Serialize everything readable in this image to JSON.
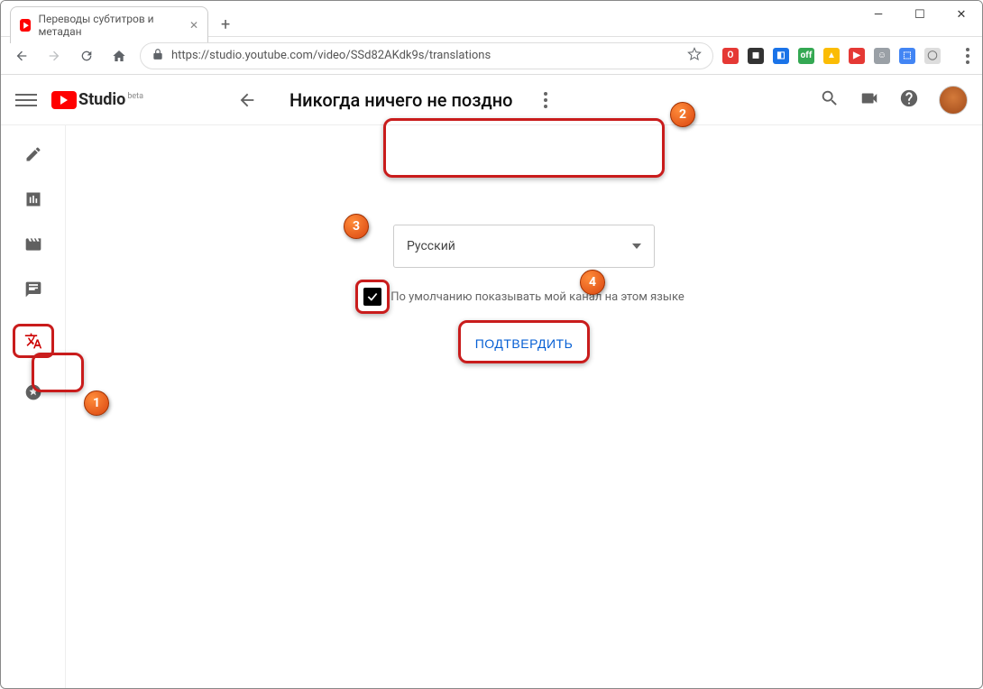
{
  "window": {
    "tab_title": "Переводы субтитров и метадан",
    "controls": {
      "min": "—",
      "max": "☐",
      "close": "✕"
    }
  },
  "browser": {
    "url": "https://studio.youtube.com/video/SSd82AKdk9s/translations"
  },
  "header": {
    "logo_text": "Studio",
    "logo_sup": "beta",
    "video_title": "Никогда ничего не поздно"
  },
  "main": {
    "language_select": "Русский",
    "checkbox_label": "По умолчанию показывать мой канал на этом языке",
    "confirm_label": "ПОДТВЕРДИТЬ"
  },
  "markers": {
    "m1": "1",
    "m2": "2",
    "m3": "3",
    "m4": "4"
  }
}
